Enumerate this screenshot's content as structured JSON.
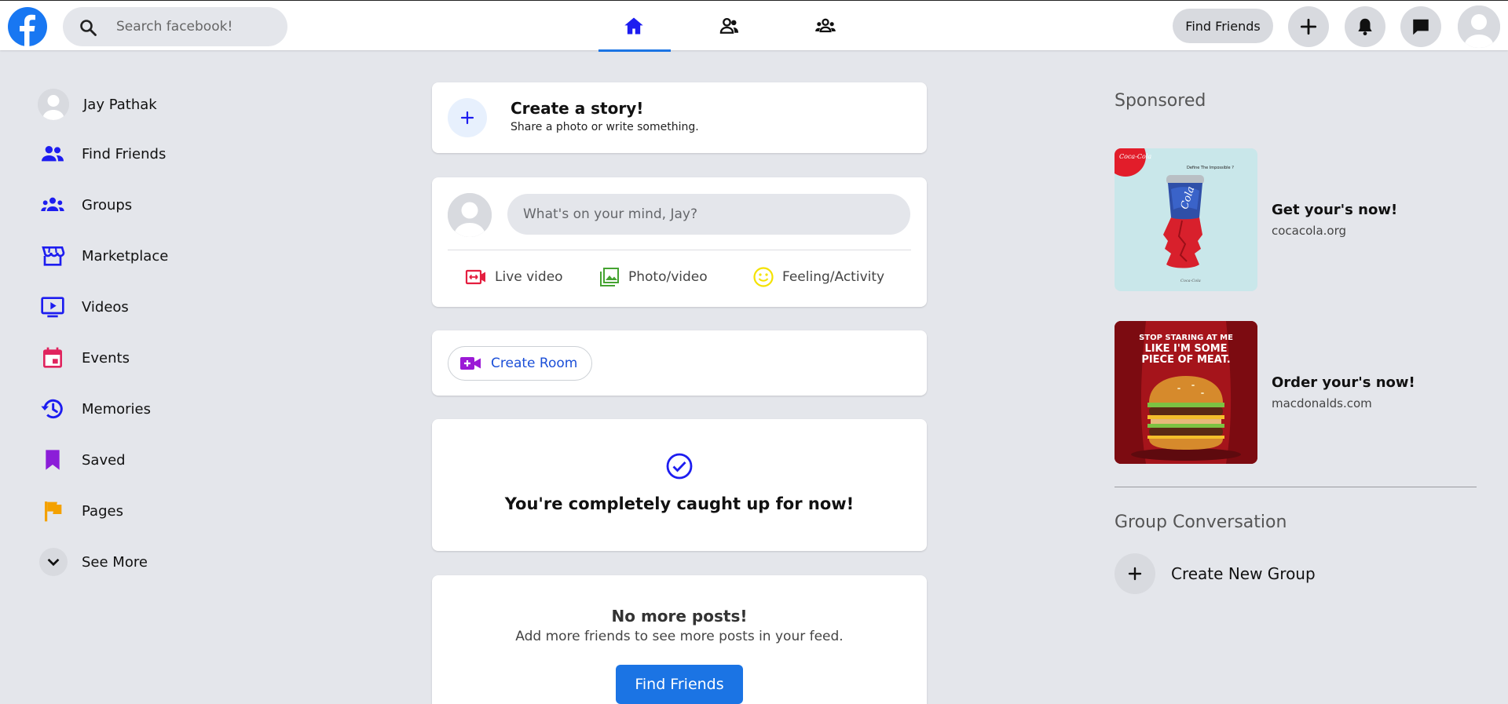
{
  "header": {
    "search_placeholder": "Search facebook!",
    "nav_tabs": [
      "home",
      "friends",
      "groups"
    ],
    "active_tab": "home",
    "find_friends_label": "Find Friends",
    "accent_color": "#1b74e4"
  },
  "sidebar": {
    "profile_name": "Jay Pathak",
    "items": [
      {
        "label": "Find Friends",
        "icon": "friends-icon",
        "color": "#1d1df0"
      },
      {
        "label": "Groups",
        "icon": "groups-icon",
        "color": "#1d1df0"
      },
      {
        "label": "Marketplace",
        "icon": "marketplace-icon",
        "color": "#1d1df0"
      },
      {
        "label": "Videos",
        "icon": "video-icon",
        "color": "#1d1df0"
      },
      {
        "label": "Events",
        "icon": "calendar-icon",
        "color": "#e0245e"
      },
      {
        "label": "Memories",
        "icon": "history-icon",
        "color": "#1d1df0"
      },
      {
        "label": "Saved",
        "icon": "bookmark-icon",
        "color": "#8b1dd8"
      },
      {
        "label": "Pages",
        "icon": "flag-icon",
        "color": "#f4a100"
      }
    ],
    "see_more_label": "See More"
  },
  "feed": {
    "story": {
      "title": "Create a story!",
      "subtitle": "Share a photo or write something."
    },
    "composer": {
      "placeholder": "What's on your mind, Jay?",
      "actions": {
        "live": "Live video",
        "photo": "Photo/video",
        "feeling": "Feeling/Activity"
      }
    },
    "room": {
      "label": "Create Room"
    },
    "caught_up": "You're completely caught up for now!",
    "no_more": {
      "title": "No more posts!",
      "subtitle": "Add more friends to see more posts in your feed.",
      "button": "Find Friends"
    }
  },
  "right": {
    "sponsored_title": "Sponsored",
    "ads": [
      {
        "headline": "Get your's now!",
        "site": "cocacola.org"
      },
      {
        "headline": "Order your's now!",
        "site": "macdonalds.com"
      }
    ],
    "ad_image_text": {
      "coke_tagline": "Define The Impossible ?",
      "burger_slogan": "STOP STARING AT ME LIKE I'M SOME PIECE OF MEAT."
    },
    "group_title": "Group Conversation",
    "create_group": "Create New Group"
  }
}
